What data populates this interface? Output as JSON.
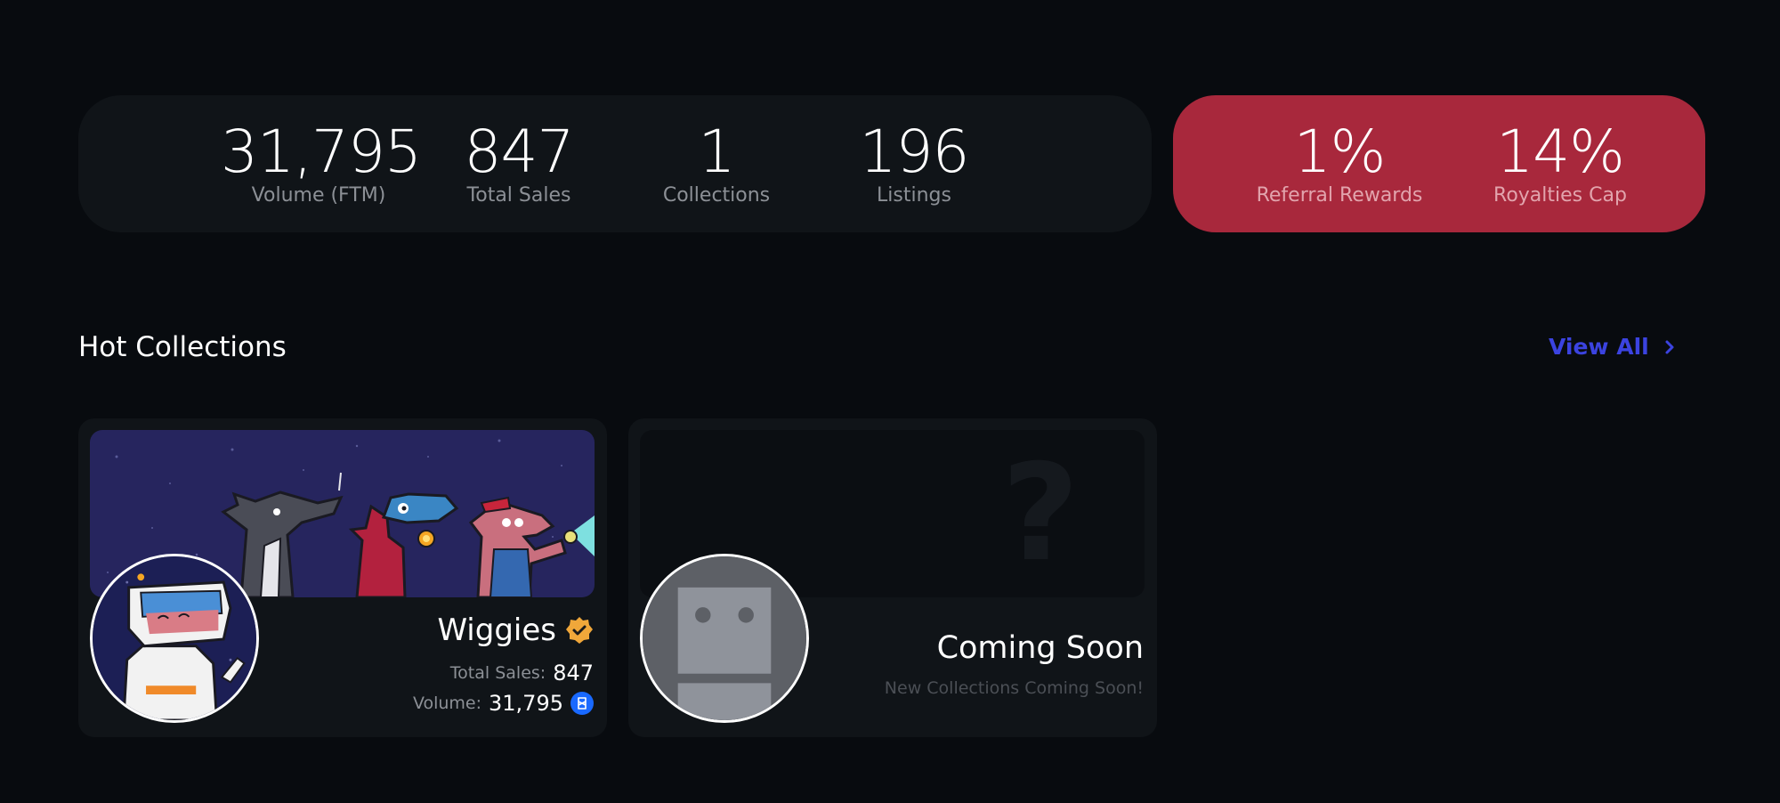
{
  "stats": [
    {
      "value": "31,795",
      "label": "Volume (FTM)"
    },
    {
      "value": "847",
      "label": "Total Sales"
    },
    {
      "value": "1",
      "label": "Collections"
    },
    {
      "value": "196",
      "label": "Listings"
    }
  ],
  "fees": [
    {
      "value": "1%",
      "label": "Referral Rewards"
    },
    {
      "value": "14%",
      "label": "Royalties Cap"
    }
  ],
  "hot_collections": {
    "title": "Hot Collections",
    "view_all": "View All",
    "cards": [
      {
        "name": "Wiggies",
        "verified": true,
        "total_sales_label": "Total Sales:",
        "total_sales": "847",
        "volume_label": "Volume:",
        "volume": "31,795",
        "currency_icon": "fantom-icon"
      },
      {
        "name": "Coming Soon",
        "subtitle": "New Collections Coming Soon!",
        "banner_glyph": "?"
      }
    ]
  },
  "colors": {
    "background": "#080b0f",
    "panel": "#101418",
    "fees_panel": "#a8283c",
    "accent_link": "#3b43e0",
    "verified_badge": "#f0a73a",
    "currency_badge": "#1969ff"
  }
}
